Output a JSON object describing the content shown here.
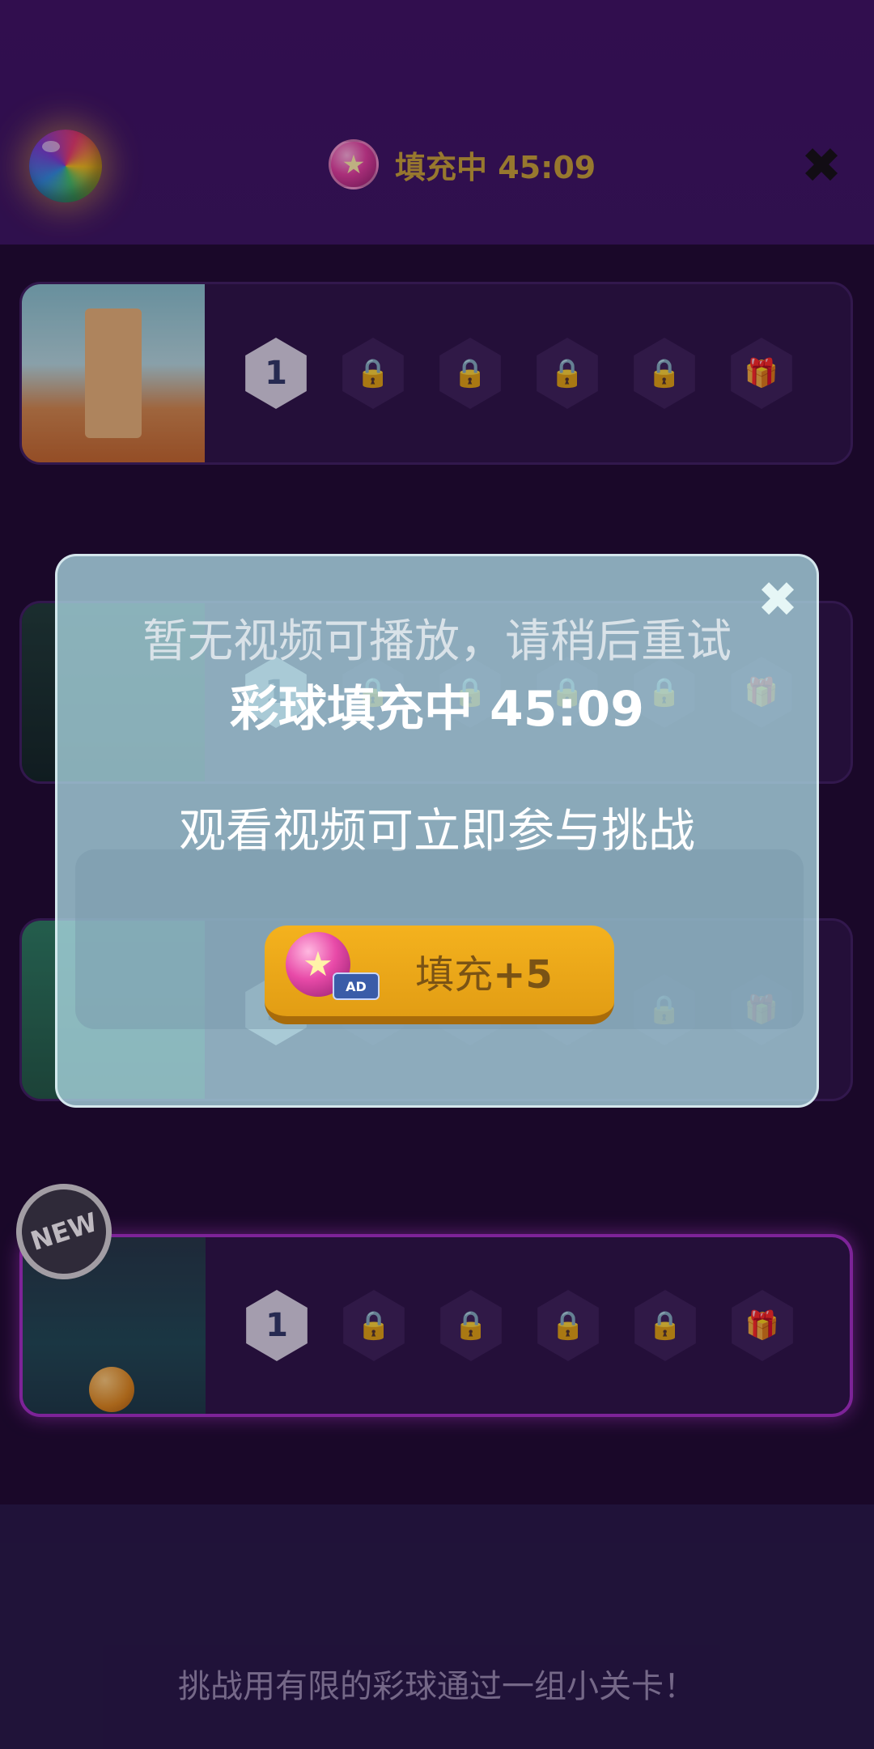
{
  "header": {
    "timer_label": "填充中",
    "timer_value": "45:09",
    "close_glyph": "✖",
    "icons": [
      "rainbow-ball-icon",
      "star-orb-icon",
      "close-icon"
    ]
  },
  "levels": [
    {
      "thumb": "thumb-level-1",
      "slots": [
        "1",
        "lock",
        "lock",
        "lock",
        "lock",
        "gift"
      ]
    },
    {
      "thumb": "thumb-level-2",
      "slots": [
        "1",
        "lock",
        "lock",
        "lock",
        "lock",
        "gift"
      ]
    },
    {
      "thumb": "thumb-level-3",
      "slots": [
        "1",
        "lock",
        "lock",
        "lock",
        "lock",
        "gift"
      ]
    },
    {
      "thumb": "thumb-level-4",
      "slots": [
        "1",
        "lock",
        "lock",
        "lock",
        "lock",
        "gift"
      ],
      "badge": "NEW"
    }
  ],
  "slot_one_label": "1",
  "new_badge": "NEW",
  "footer": {
    "text": "挑战用有限的彩球通过一组小关卡！"
  },
  "modal": {
    "close_glyph": "✖",
    "title": "彩球填充中 45:09",
    "subtitle": "观看视频可立即参与挑战",
    "toast": "暂无视频可播放，请稍后重试",
    "button_label_prefix": "填充",
    "button_label_amount": "+5",
    "ad_label": "AD"
  },
  "colors": {
    "header_bg": "#3c1262",
    "page_bg": "#1c0b2e",
    "button_gold": "#f4b21e",
    "modal_bg": "#aad7e1",
    "timer_text": "#c9a535"
  }
}
